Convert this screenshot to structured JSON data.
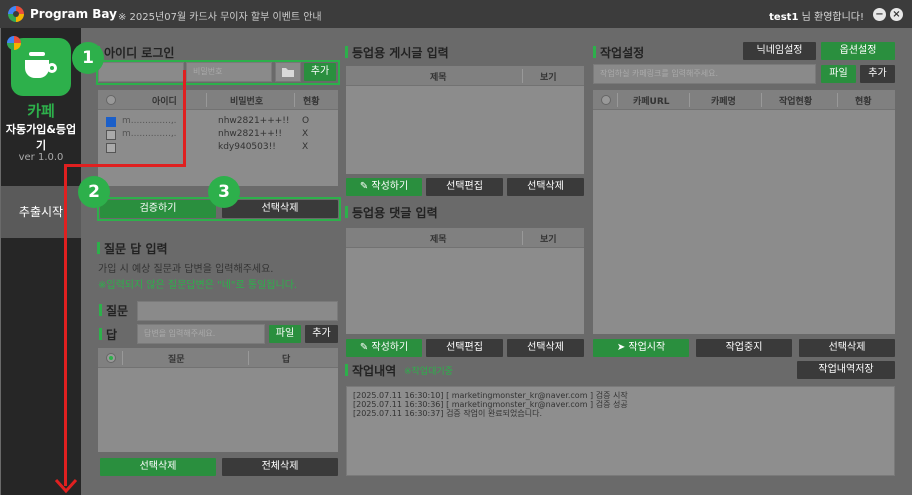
{
  "titlebar": {
    "app_name": "Program Bay",
    "notice": "※ 2025년07월 카드사 무이자 할부 이벤트 안내",
    "user_name": "test1",
    "user_greeting": "님 환영합니다!"
  },
  "sidebar": {
    "title1": "카페",
    "title2": "자동가입&등업기",
    "version": "ver 1.0.0",
    "start_label": "추출시작"
  },
  "login": {
    "title": "아이디 로그인",
    "id_placeholder": "",
    "pw_placeholder": "비밀번호",
    "add_label": "추가",
    "col_id": "아이디",
    "col_pw": "비밀번호",
    "col_status": "현황",
    "rows": [
      {
        "id": "m..............,.",
        "pw": "nhw2821+++!!",
        "status": "O",
        "checked": true
      },
      {
        "id": "m..............,.",
        "pw": "nhw2821++!!",
        "status": "X",
        "checked": false
      },
      {
        "id": "",
        "pw": "kdy940503!!",
        "status": "X",
        "checked": false
      }
    ],
    "verify_label": "검증하기",
    "delete_selected_label": "선택삭제"
  },
  "qa": {
    "title": "질문 답 입력",
    "desc": "가입 시 예상 질문과 답변을 입력해주세요.",
    "note": "※입력되지 않은 질문답변은 \"네\"로 통일됩니다.",
    "question_label": "질문",
    "answer_label": "답",
    "answer_placeholder": "답변을 입력해주세요.",
    "file_label": "파일",
    "add_label": "추가",
    "col_question": "질문",
    "col_answer": "답",
    "delete_selected_label": "선택삭제",
    "delete_all_label": "전체삭제"
  },
  "post": {
    "title": "등업용 게시글 입력",
    "col_title": "제목",
    "col_view": "보기",
    "write_label": "작성하기",
    "edit_label": "선택편집",
    "delete_label": "선택삭제"
  },
  "comment": {
    "title": "등업용 댓글 입력",
    "col_title": "제목",
    "col_view": "보기",
    "write_label": "작성하기",
    "edit_label": "선택편집",
    "delete_label": "선택삭제"
  },
  "work": {
    "title": "작업설정",
    "nickname_label": "닉네임설정",
    "option_label": "옵션설정",
    "url_placeholder": "작업하실 카페링크를 입력해주세요.",
    "file_label": "파일",
    "add_label": "추가",
    "col_url": "카페URL",
    "col_name": "카페명",
    "col_progress": "작업현황",
    "col_status": "현황",
    "start_label": "작업시작",
    "stop_label": "작업중지",
    "delete_label": "선택삭제"
  },
  "history": {
    "title": "작업내역",
    "status": "※작업대기중",
    "save_label": "작업내역저장",
    "lines": [
      "[2025.07.11 16:30:10] [ marketingmonster_kr@naver.com ] 검증 시작",
      "[2025.07.11 16:30:36] [ marketingmonster_kr@naver.com ] 검증 성공",
      "[2025.07.11 16:30:37] 검증 작업이 완료되었습니다."
    ]
  },
  "steps": {
    "one": "1",
    "two": "2",
    "three": "3"
  },
  "colors": {
    "accent": "#2db04b",
    "arrow": "#e02020"
  }
}
